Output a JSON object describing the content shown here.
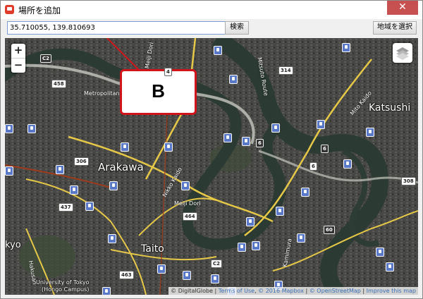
{
  "window": {
    "title": "場所を追加",
    "close_label": "✕",
    "app_icon": "app-icon"
  },
  "toolbar": {
    "coordinate_value": "35.710055, 139.810693",
    "search_label": "検索",
    "region_label": "地域を選択"
  },
  "map": {
    "zoom_in": "+",
    "zoom_out": "−",
    "callout_label": "B",
    "places": [
      {
        "name": "Arakawa"
      },
      {
        "name": "Taito"
      },
      {
        "name": "Katsushi"
      },
      {
        "name": "kyo"
      },
      {
        "name": "University of Tokyo"
      },
      {
        "name": "(Hongo Campus)"
      }
    ],
    "roads": [
      {
        "name": "Metropolitan"
      },
      {
        "name": "Meiji Dori"
      },
      {
        "name": "Nikko Kaido"
      },
      {
        "name": "Meiji Dori"
      },
      {
        "name": "Mito Kaido"
      },
      {
        "name": "Mitsuto Route"
      },
      {
        "name": "Hakusan"
      },
      {
        "name": "Kamimura"
      }
    ],
    "shields": [
      "C2",
      "458",
      "306",
      "437",
      "463",
      "464",
      "314",
      "6",
      "6",
      "308",
      "60",
      "C2",
      "6",
      "4"
    ],
    "attribution": {
      "prefix": "© DigitalGlobe",
      "terms": "Terms of Use",
      "mapbox": "© 2016 Mapbox",
      "osm": "© OpenStreetMap",
      "improve": "Improve this map"
    },
    "colors": {
      "river": "#2a3a33",
      "road": "#e6c848",
      "rail": "#9e3b1c",
      "pointer": "#d0141c",
      "station": "#5a78c8"
    }
  }
}
